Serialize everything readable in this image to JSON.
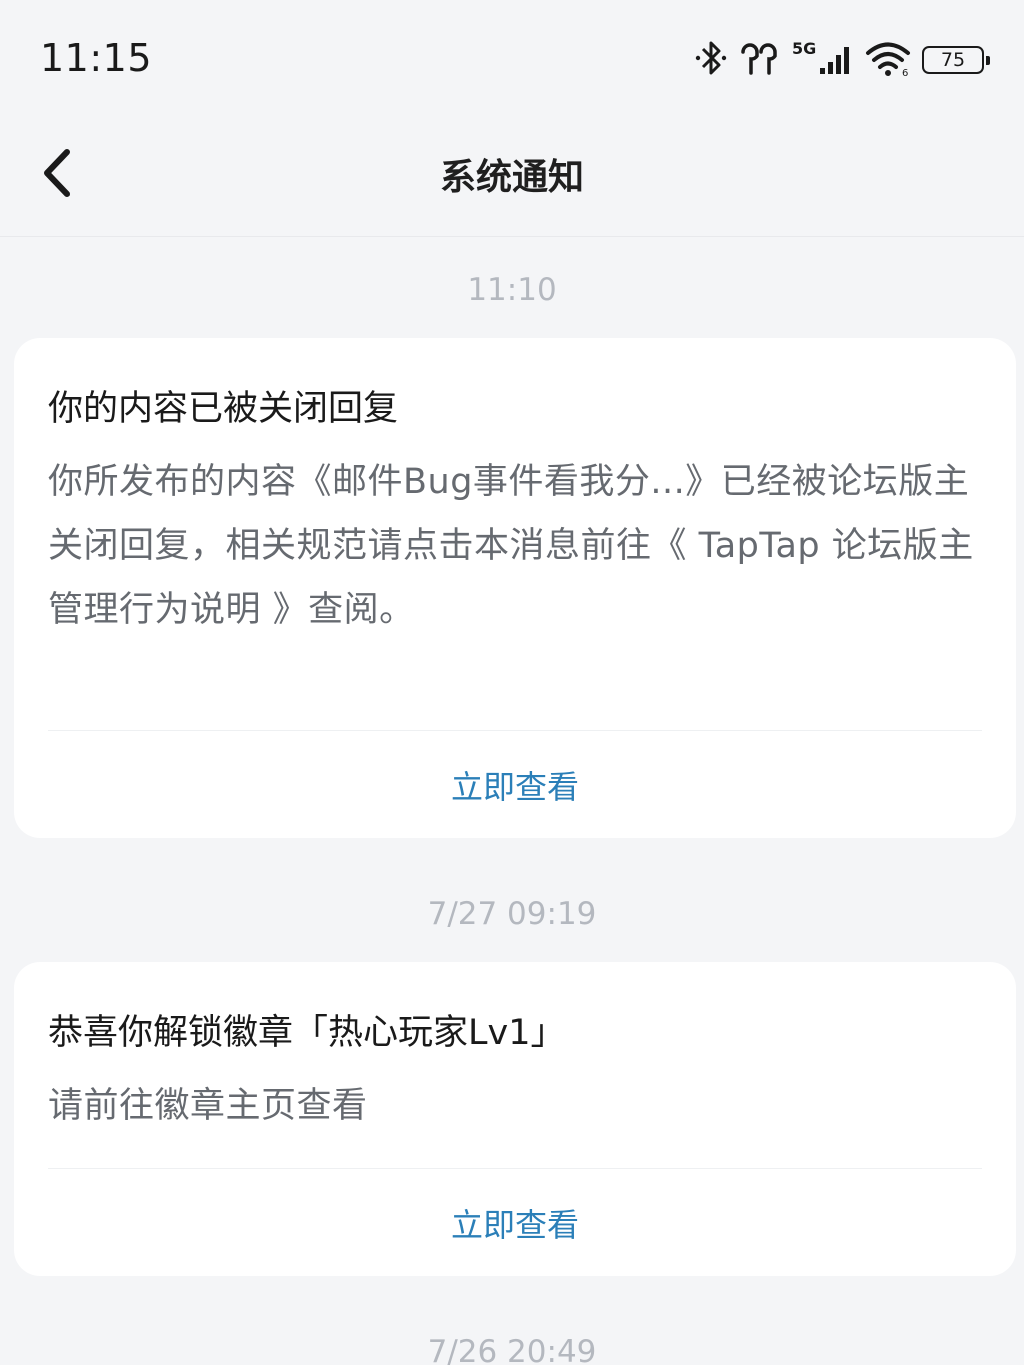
{
  "status_bar": {
    "time": "11:15",
    "battery": "75",
    "icons": [
      "bluetooth-icon",
      "earbuds-icon",
      "5g-signal-icon",
      "wifi-icon",
      "battery-icon"
    ],
    "network_label": "5G"
  },
  "header": {
    "title": "系统通知",
    "back_icon": "chevron-left-icon"
  },
  "notifications": [
    {
      "timestamp": "11:10",
      "title": "你的内容已被关闭回复",
      "body": "你所发布的内容《邮件Bug事件看我分...》已经被论坛版主关闭回复，相关规范请点击本消息前往《 TapTap 论坛版主管理行为说明 》查阅。",
      "action": "立即查看"
    },
    {
      "timestamp": "7/27  09:19",
      "title": "恭喜你解锁徽章「热心玩家Lv1」",
      "body": "请前往徽章主页查看",
      "action": "立即查看"
    },
    {
      "timestamp": "7/26  20:49"
    }
  ],
  "colors": {
    "background": "#f4f5f7",
    "card": "#ffffff",
    "accent": "#2b7fb8",
    "timestamp": "#b4b8bf",
    "body_text": "#666a70"
  }
}
